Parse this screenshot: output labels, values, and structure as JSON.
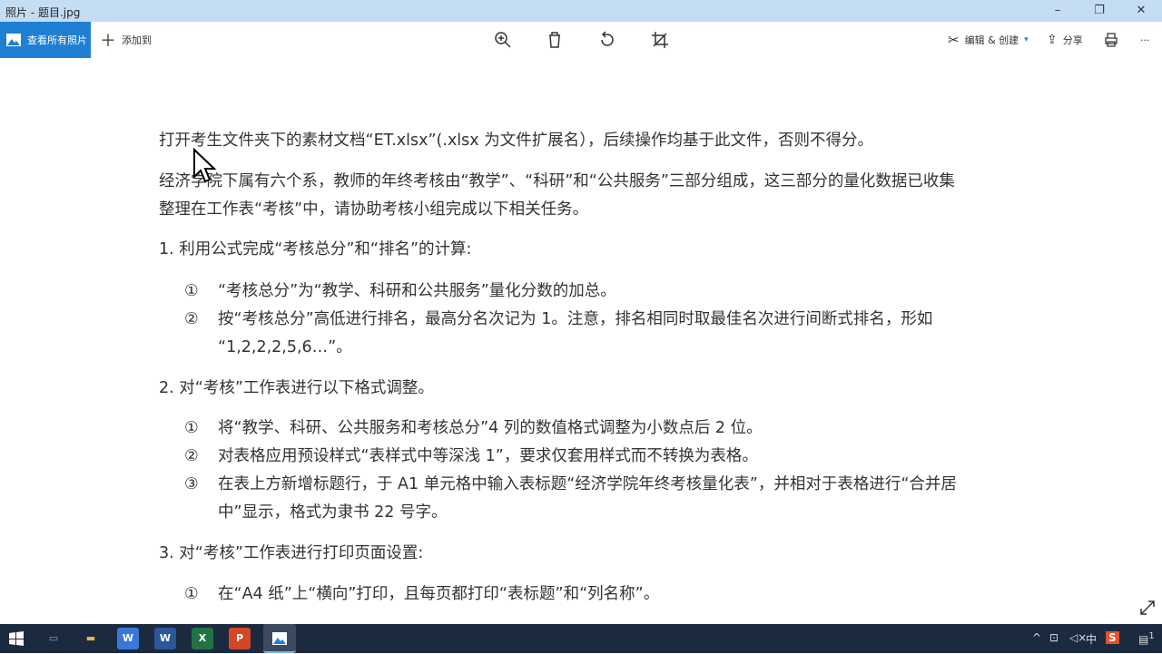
{
  "window": {
    "title": "照片 - 题目.jpg",
    "minimize": "–",
    "maximize": "❐",
    "close": "✕"
  },
  "toolbar": {
    "all_photos": "查看所有照片",
    "add_to": "添加到",
    "edit_create": "编辑 & 创建",
    "share": "分享",
    "more": "···"
  },
  "content": {
    "lines": [
      "打开考生文件夹下的素材文档“ET.xlsx”(.xlsx 为文件扩展名），后续操作均基于此文件，否则不得分。",
      "经济学院下属有六个系，教师的年终考核由“教学”、“科研”和“公共服务”三部分组成，这三部分的量化数据已收集",
      "整理在工作表“考核”中，请协助考核小组完成以下相关任务。",
      "1. 利用公式完成“考核总分”和“排名”的计算:"
    ],
    "sec1": [
      {
        "num": "①",
        "text": "“考核总分”为“教学、科研和公共服务”量化分数的加总。"
      },
      {
        "num": "②",
        "text": "按“考核总分”高低进行排名，最高分名次记为 1。注意，排名相同时取最佳名次进行间断式排名，形如"
      },
      {
        "num": "",
        "text": "“1,2,2,2,5,6…”。"
      }
    ],
    "sec2_title": "2. 对“考核”工作表进行以下格式调整。",
    "sec2": [
      {
        "num": "①",
        "text": "将“教学、科研、公共服务和考核总分”4 列的数值格式调整为小数点后 2 位。"
      },
      {
        "num": "②",
        "text": "对表格应用预设样式“表样式中等深浅 1”，要求仅套用样式而不转换为表格。"
      },
      {
        "num": "③",
        "text": "在表上方新增标题行，于 A1 单元格中输入表标题“经济学院年终考核量化表”，并相对于表格进行“合并居"
      },
      {
        "num": "",
        "text": "中”显示，格式为隶书 22 号字。"
      }
    ],
    "sec3_title": "3. 对“考核”工作表进行打印页面设置:",
    "sec3": [
      {
        "num": "①",
        "text": "在“A4 纸”上“横向”打印，且每页都打印“表标题”和“列名称”。"
      }
    ]
  },
  "taskbar": {
    "wps": "W",
    "word": "W",
    "excel": "X",
    "ppt": "P",
    "ime": "中",
    "sogou": "S",
    "notif_count": "1"
  },
  "colors": {
    "accent": "#1f7fd3",
    "taskbar": "#1c2a3f",
    "titlebar": "#c4ddf3"
  }
}
